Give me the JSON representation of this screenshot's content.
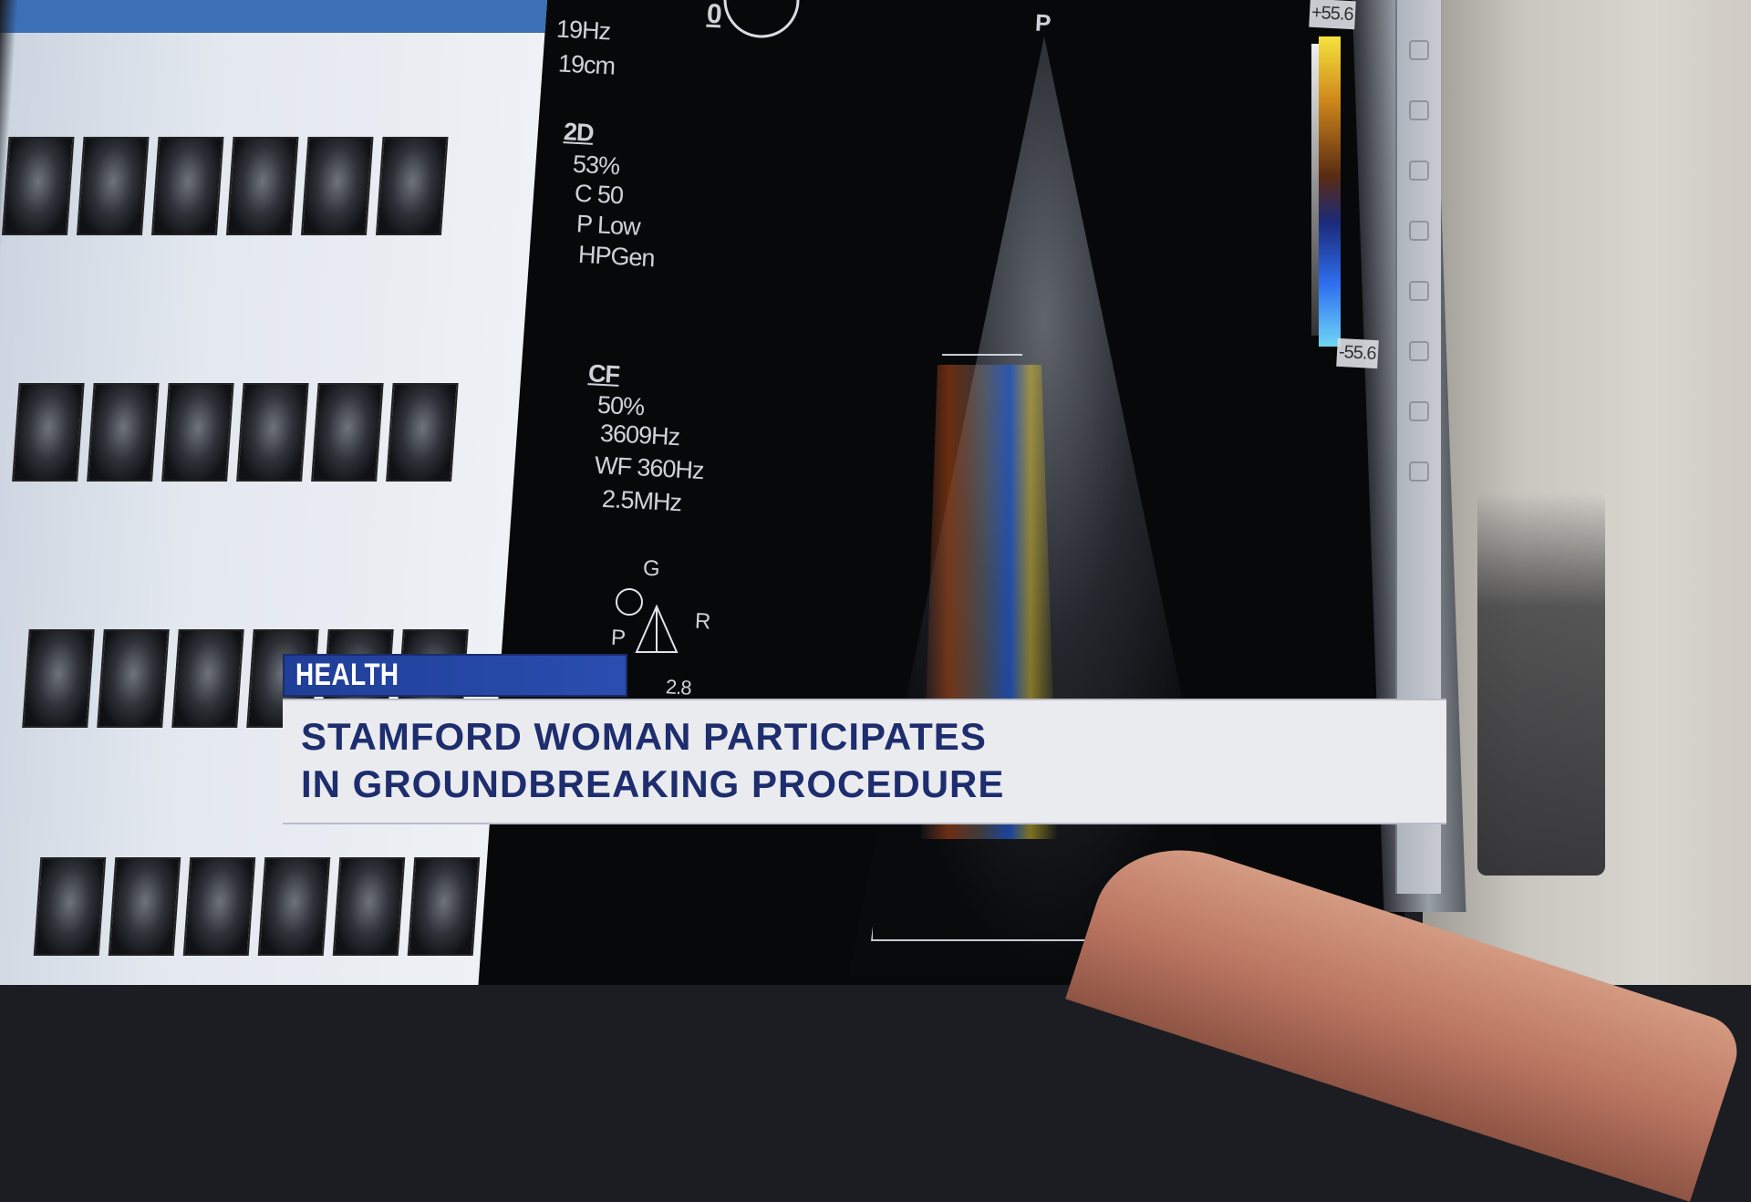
{
  "scene": {
    "description_visible": false,
    "colors": {
      "wall": "#d6d3cd",
      "screen": "#07080a",
      "doppler_blue": "#2f6ff0",
      "doppler_yellow": "#f5e33d",
      "doppler_red": "#c8501a"
    }
  },
  "ultrasound": {
    "header_freq": "19Hz",
    "header_depth": "19cm",
    "mode_2d": "2D",
    "settings_2d": [
      "53%",
      "C 50",
      "P Low",
      "HPGen"
    ],
    "mode_cf": "CF",
    "settings_cf": [
      "50%",
      "3609Hz",
      "WF 360Hz",
      "2.5MHz"
    ],
    "scale_top": "+55.6",
    "scale_bottom": "-55.6",
    "zero_marker": "0",
    "probe_marker": "P",
    "orientation_letters": {
      "g": "G",
      "p": "P",
      "r": "R",
      "num": "2.8"
    }
  },
  "lower_third": {
    "category": "HEALTH",
    "headline_line1": "STAMFORD WOMAN PARTICIPATES",
    "headline_line2": "IN GROUNDBREAKING PROCEDURE",
    "colors": {
      "category_bg": "#2a4eb0",
      "headline_bg": "#eaebef",
      "headline_text": "#1d2d6e"
    }
  }
}
